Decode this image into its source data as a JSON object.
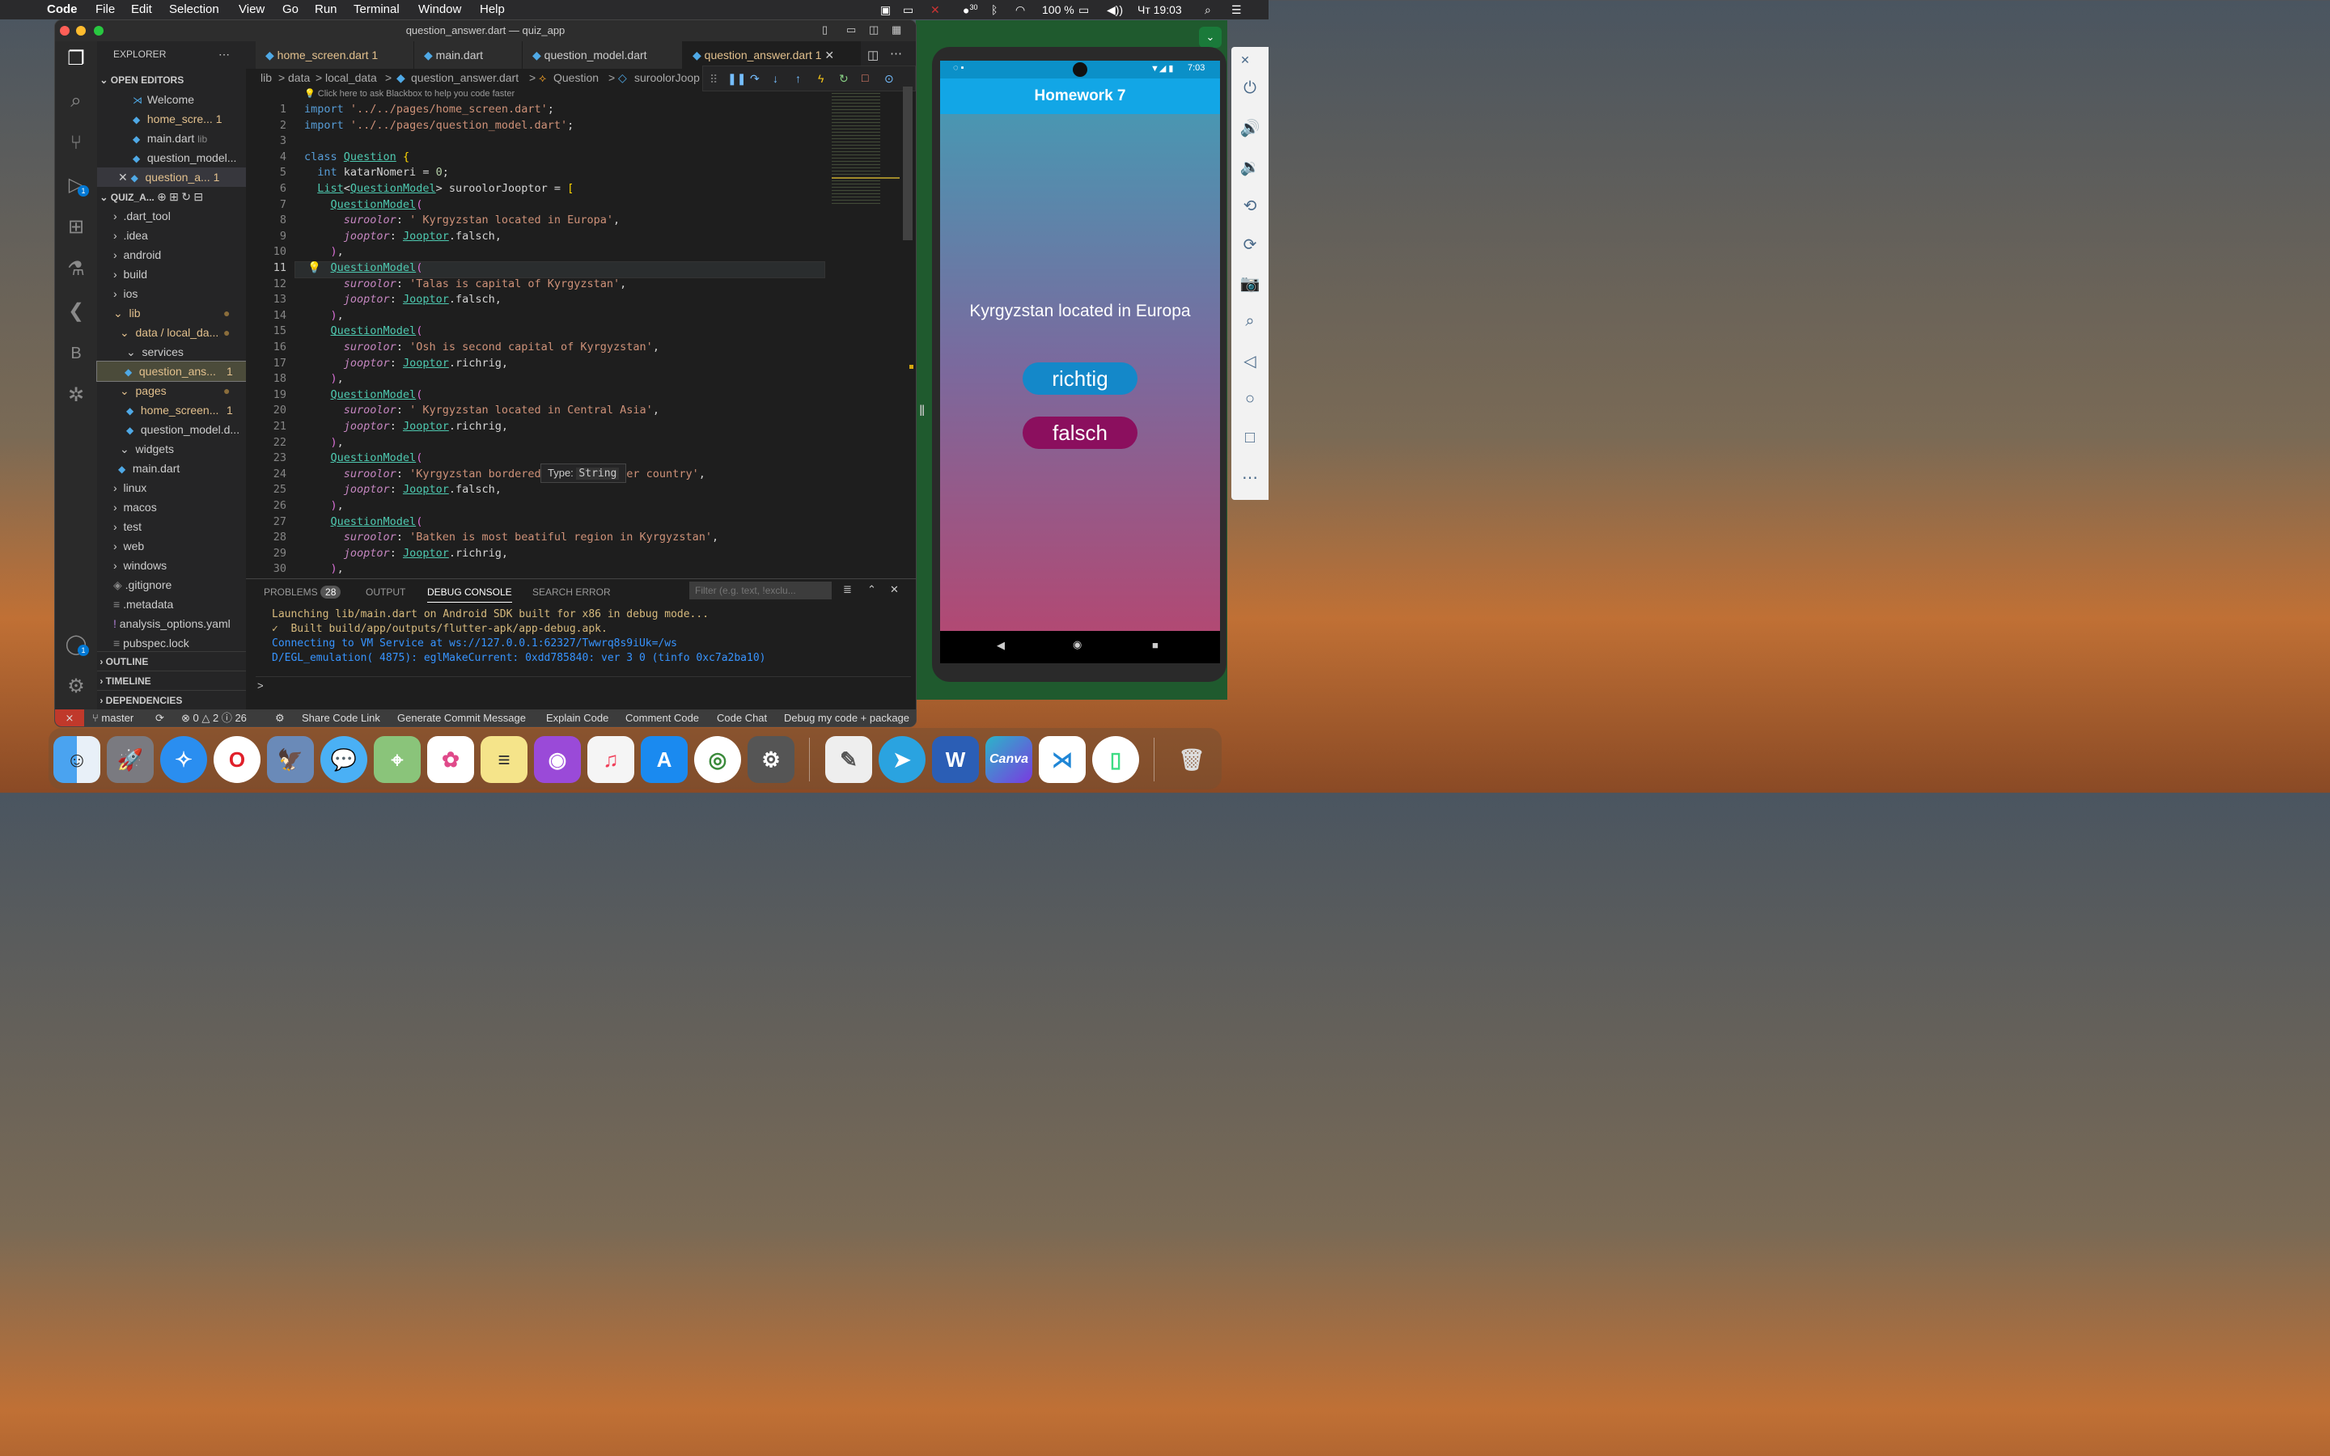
{
  "menubar": {
    "app": "Code",
    "items": [
      "File",
      "Edit",
      "Selection",
      "View",
      "Go",
      "Run",
      "Terminal",
      "Window",
      "Help"
    ],
    "battery": "100 %",
    "clock": "Чт 19:03",
    "badge": "30"
  },
  "window": {
    "title": "question_answer.dart — quiz_app"
  },
  "explorer": {
    "header": "EXPLORER",
    "open_editors_label": "OPEN EDITORS",
    "open_editors": [
      {
        "label": "Welcome",
        "badge": ""
      },
      {
        "label": "home_scre...",
        "badge": "1"
      },
      {
        "label": "main.dart",
        "suffix": "lib",
        "badge": ""
      },
      {
        "label": "question_model...",
        "badge": ""
      },
      {
        "label": "question_a...",
        "badge": "1"
      }
    ],
    "project_label": "QUIZ_A...",
    "tree": [
      ".dart_tool",
      ".idea",
      "android",
      "build",
      "ios",
      "lib",
      "data / local_da...",
      "services",
      "question_ans...",
      "pages",
      "home_screen...",
      "question_model.d...",
      "widgets",
      "main.dart",
      "linux",
      "macos",
      "test",
      "web",
      "windows",
      ".gitignore",
      ".metadata",
      "analysis_options.yaml",
      "pubspec.lock"
    ],
    "tree_badges": {
      "question_ans": "1",
      "home_screen": "1"
    },
    "outline": "OUTLINE",
    "timeline": "TIMELINE",
    "dependencies": "DEPENDENCIES",
    "debug_badge": "1",
    "account_badge": "1"
  },
  "tabs": [
    {
      "label": "home_screen.dart",
      "badge": "1"
    },
    {
      "label": "main.dart",
      "badge": ""
    },
    {
      "label": "question_model.dart",
      "badge": ""
    },
    {
      "label": "question_answer.dart",
      "badge": "1"
    }
  ],
  "breadcrumb": {
    "parts": [
      "lib",
      ">",
      "data",
      ">",
      "local_data",
      ">",
      "question_answer.dart",
      ">",
      "Question",
      ">",
      "suroolorJoop"
    ],
    "hint": "Click here to ask Blackbox to help you code faster"
  },
  "code": {
    "line_numbers": [
      "1",
      "2",
      "3",
      "4",
      "5",
      "6",
      "7",
      "8",
      "9",
      "10",
      "11",
      "12",
      "13",
      "14",
      "15",
      "16",
      "17",
      "18",
      "19",
      "20",
      "21",
      "22",
      "23",
      "24",
      "25",
      "26",
      "27",
      "28",
      "29",
      "30"
    ],
    "lines": [
      "import '../../pages/home_screen.dart';",
      "import '../../pages/question_model.dart';",
      "",
      "class Question {",
      "  int katarNomeri = 0;",
      "  List<QuestionModel> suroolorJooptor = [",
      "    QuestionModel(",
      "      suroolor: ' Kyrgyzstan located in Europa',",
      "      jooptor: Jooptor.falsch,",
      "    ),",
      "    QuestionModel(",
      "      suroolor: 'Talas is capital of Kyrgyzstan',",
      "      jooptor: Jooptor.falsch,",
      "    ),",
      "    QuestionModel(",
      "      suroolor: 'Osh is second capital of Kyrgyzstan',",
      "      jooptor: Jooptor.richrig,",
      "    ),",
      "    QuestionModel(",
      "      suroolor: ' Kyrgyzstan located in Central Asia',",
      "      jooptor: Jooptor.richrig,",
      "    ),",
      "    QuestionModel(",
      "      suroolor: 'Kyrgyzstan bordered with 5 another country',",
      "      jooptor: Jooptor.falsch,",
      "    ),",
      "    QuestionModel(",
      "      suroolor: 'Batken is most beatiful region in Kyrgyzstan',",
      "      jooptor: Jooptor.richrig,",
      "    ),"
    ],
    "tooltip_label": "Type:",
    "tooltip_value": "String"
  },
  "panel": {
    "tabs": [
      "PROBLEMS",
      "OUTPUT",
      "DEBUG CONSOLE",
      "SEARCH ERROR"
    ],
    "problems_count": "28",
    "filter_placeholder": "Filter (e.g. text, !exclu...",
    "lines": [
      "Launching lib/main.dart on Android SDK built for x86 in debug mode...",
      "✓  Built build/app/outputs/flutter-apk/app-debug.apk.",
      "Connecting to VM Service at ws://127.0.0.1:62327/Twwrq8s9iUk=/ws",
      "D/EGL_emulation( 4875): eglMakeCurrent: 0xdd785840: ver 3 0 (tinfo 0xc7a2ba10)"
    ],
    "prompt": ">"
  },
  "statusbar": {
    "branch": "master",
    "errors": "0",
    "warnings": "2",
    "info": "26",
    "items": [
      "Share Code Link",
      "Generate Commit Message",
      "Explain Code",
      "Comment Code",
      "Code Chat",
      "Debug my code + package"
    ]
  },
  "phone": {
    "time": "7:03",
    "app_title": "Homework 7",
    "question": "Kyrgyzstan located in Europa",
    "true_button": "richtig",
    "false_button": "falsch",
    "colors": {
      "appbar": "#12a6e6",
      "true_btn": "#1488c9",
      "false_btn": "#8b0f5e"
    }
  },
  "dock": {
    "apps": [
      "finder-icon",
      "launchpad-icon",
      "safari-icon",
      "opera-icon",
      "preview-icon",
      "messages-icon",
      "maps-icon",
      "photos-icon",
      "notes-icon",
      "podcasts-icon",
      "music-icon",
      "appstore-icon",
      "chrome-icon",
      "system-preferences-icon",
      "textedit-icon",
      "telegram-icon",
      "word-icon",
      "canva-icon",
      "vscode-icon",
      "android-studio-icon",
      "trash-icon"
    ],
    "word_label": "W",
    "canva_label": "Canva"
  }
}
